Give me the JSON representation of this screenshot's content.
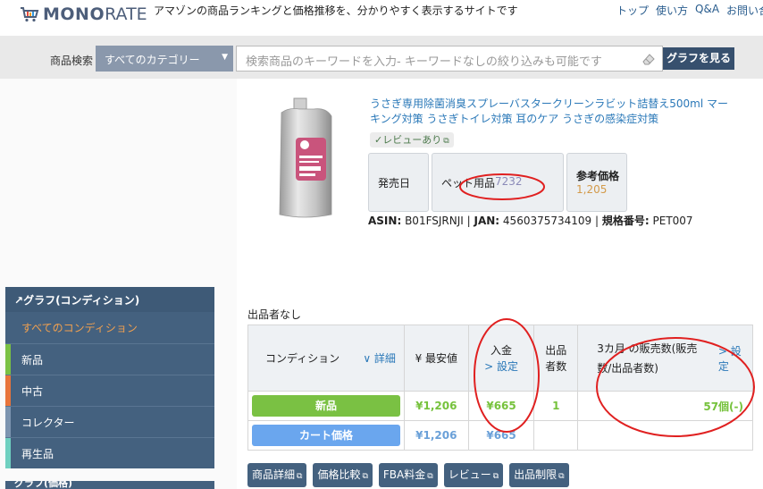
{
  "header": {
    "brand_a": "MONO",
    "brand_b": "RATE",
    "tagline": "アマゾンの商品ランキングと価格推移を、分かりやすく表示するサイトです",
    "nav": [
      "トップ",
      "使い方",
      "Q&A",
      "お問い合"
    ]
  },
  "search": {
    "label": "商品検索",
    "category": "すべてのカテゴリー",
    "placeholder": "検索商品のキーワードを入力- キーワードなしの絞り込みも可能です",
    "button": "グラフを見る"
  },
  "product": {
    "title": "うさぎ専用除菌消臭スプレーバスタークリーンラビット詰替え500ml マーキング対策 うさぎトイレ対策 耳のケア うさぎの感染症対策",
    "review_badge": "✓レビューあり",
    "release_label": "発売日",
    "rank_category": "ペット用品",
    "rank_value": "7232",
    "price_label": "参考価格",
    "price_value": "1,205",
    "asin_label": "ASIN:",
    "asin": "B01FSJRNJI",
    "jan_label": "JAN:",
    "jan": "4560375734109",
    "model_label": "規格番号:",
    "model": "PET007"
  },
  "sidebar": {
    "heading": "グラフ(コンディション)",
    "items": [
      {
        "label": "すべてのコンディション",
        "color": "#f0a050"
      },
      {
        "label": "新品",
        "color": "#7ac143"
      },
      {
        "label": "中古",
        "color": "#e8743b"
      },
      {
        "label": "コレクター",
        "color": "#7d95b0"
      },
      {
        "label": "再生品",
        "color": "#6fd0c0"
      }
    ],
    "heading2": "グラフ(価格)"
  },
  "sellers": {
    "none_label": "出品者なし",
    "headers": {
      "condition": "コンディション",
      "detail": "∨ 詳細",
      "min_price": "¥ 最安値",
      "deposit": "入金",
      "deposit_setting": "> 設定",
      "sellers": "出品者数",
      "sales": "3カ月 の販売数(販売数/出品者数)",
      "sales_setting": "> 設定"
    },
    "rows": [
      {
        "label": "新品",
        "min_price": "¥1,206",
        "deposit": "¥665",
        "sellers": "1",
        "sales": "57個(-)"
      },
      {
        "label": "カート価格",
        "min_price": "¥1,206",
        "deposit": "¥665",
        "sellers": "",
        "sales": ""
      }
    ]
  },
  "buttons": [
    "商品詳細",
    "価格比較",
    "FBA料金",
    "レビュー",
    "出品制限"
  ]
}
